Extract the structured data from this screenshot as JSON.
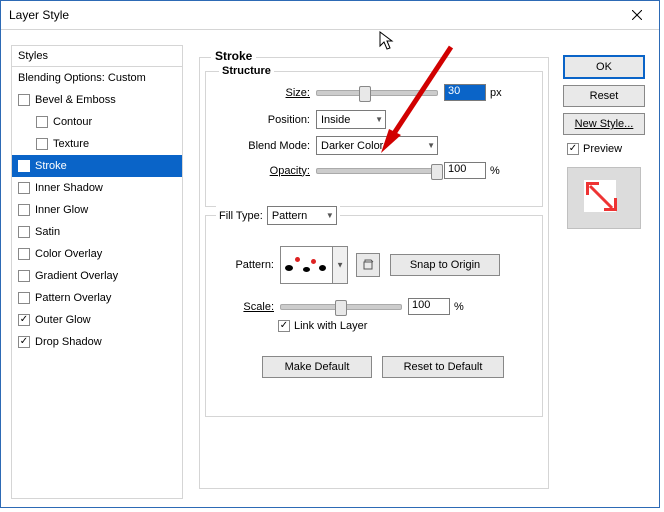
{
  "window": {
    "title": "Layer Style"
  },
  "styles": {
    "header": "Styles",
    "blending": "Blending Options: Custom",
    "items": [
      {
        "label": "Bevel & Emboss",
        "checked": false,
        "indent": false
      },
      {
        "label": "Contour",
        "checked": false,
        "indent": true
      },
      {
        "label": "Texture",
        "checked": false,
        "indent": true
      },
      {
        "label": "Stroke",
        "checked": true,
        "indent": false,
        "selected": true
      },
      {
        "label": "Inner Shadow",
        "checked": false,
        "indent": false
      },
      {
        "label": "Inner Glow",
        "checked": false,
        "indent": false
      },
      {
        "label": "Satin",
        "checked": false,
        "indent": false
      },
      {
        "label": "Color Overlay",
        "checked": false,
        "indent": false
      },
      {
        "label": "Gradient Overlay",
        "checked": false,
        "indent": false
      },
      {
        "label": "Pattern Overlay",
        "checked": false,
        "indent": false
      },
      {
        "label": "Outer Glow",
        "checked": true,
        "indent": false
      },
      {
        "label": "Drop Shadow",
        "checked": true,
        "indent": false
      }
    ]
  },
  "stroke": {
    "title": "Stroke",
    "structure": {
      "title": "Structure",
      "size_label": "Size:",
      "size_value": "30",
      "size_unit": "px",
      "position_label": "Position:",
      "position_value": "Inside",
      "blend_label": "Blend Mode:",
      "blend_value": "Darker Color",
      "opacity_label": "Opacity:",
      "opacity_value": "100",
      "opacity_unit": "%"
    },
    "fill": {
      "type_label": "Fill Type:",
      "type_value": "Pattern",
      "pattern_label": "Pattern:",
      "snap_label": "Snap to Origin",
      "scale_label": "Scale:",
      "scale_value": "100",
      "scale_unit": "%",
      "link_label": "Link with Layer"
    },
    "footer": {
      "make_default": "Make Default",
      "reset_default": "Reset to Default"
    }
  },
  "right": {
    "ok": "OK",
    "reset": "Reset",
    "new_style": "New Style...",
    "preview": "Preview"
  }
}
